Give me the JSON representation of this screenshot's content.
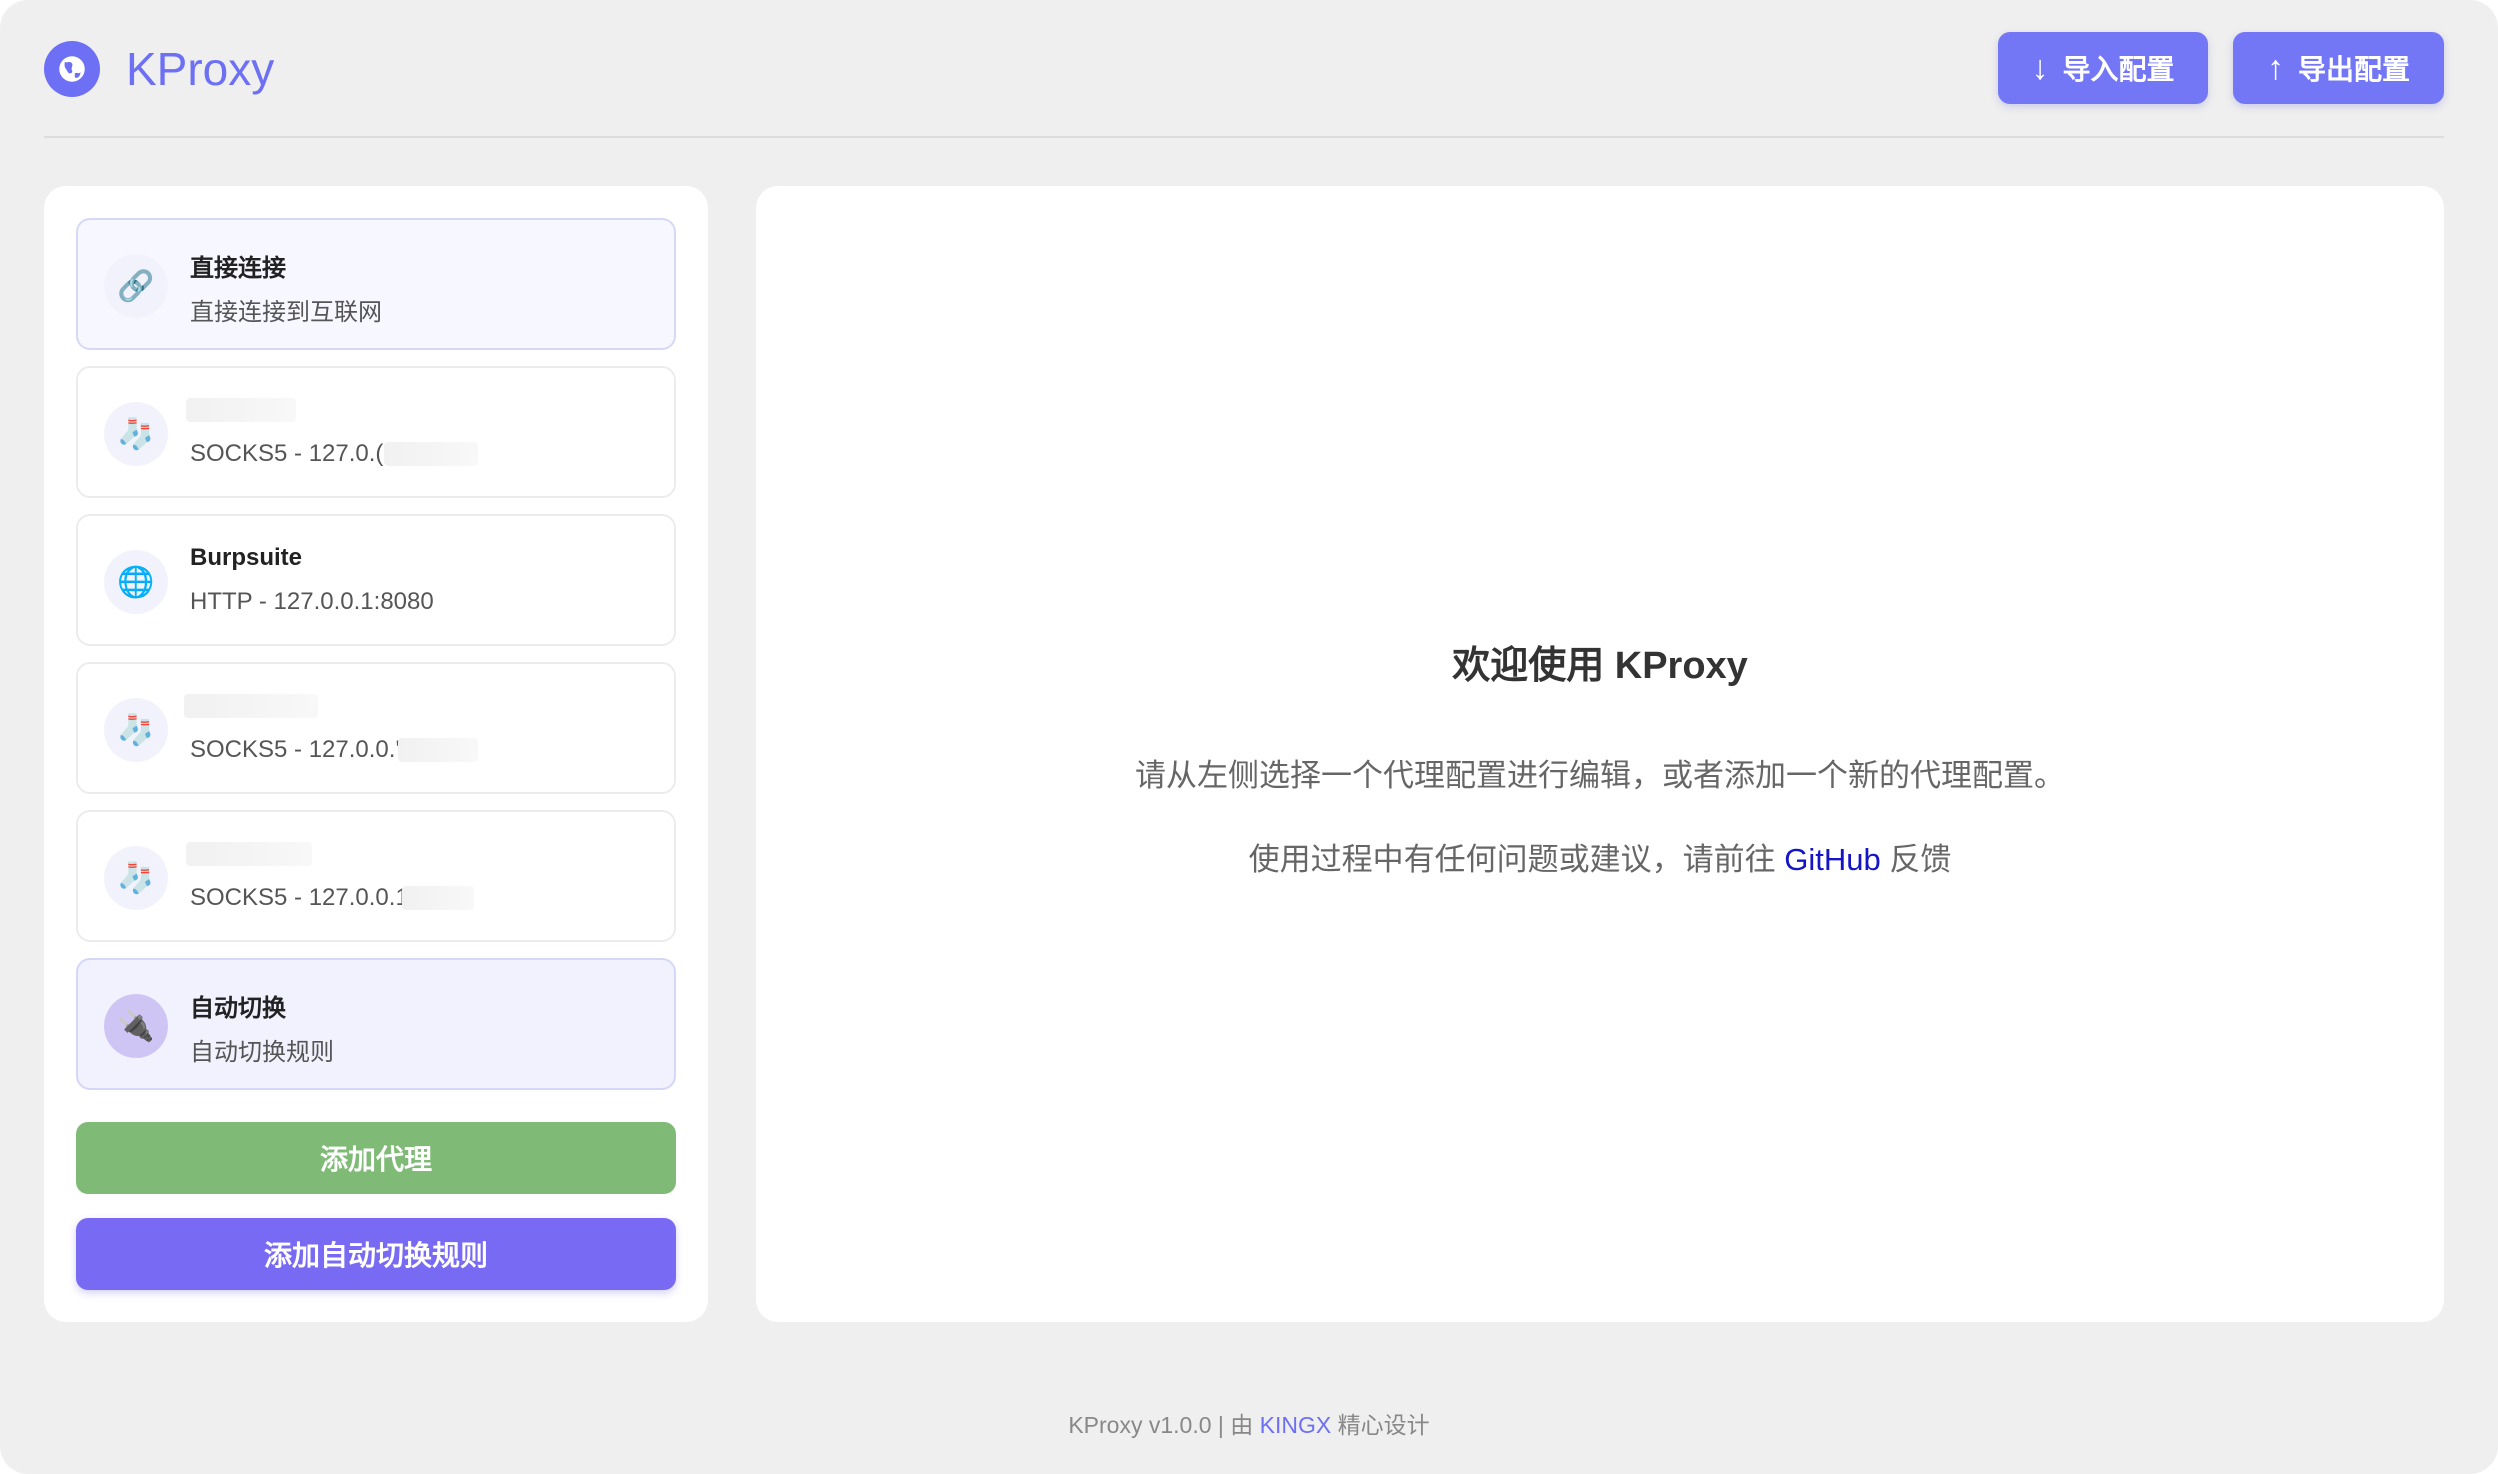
{
  "header": {
    "app_title": "KProxy",
    "brand_icon": "globe-icon",
    "import_button": {
      "icon": "↓",
      "label": "导入配置"
    },
    "export_button": {
      "icon": "↑",
      "label": "导出配置"
    }
  },
  "sidebar": {
    "items": [
      {
        "icon": "🔗",
        "icon_name": "link-icon",
        "title": "直接连接",
        "subtitle": "直接连接到互联网"
      },
      {
        "icon": "🧦",
        "icon_name": "sock-icon",
        "title": "",
        "subtitle": "SOCKS5 - 127.0.("
      },
      {
        "icon": "🌐",
        "icon_name": "globe-icon",
        "title": "Burpsuite",
        "subtitle": "HTTP - 127.0.0.1:8080"
      },
      {
        "icon": "🧦",
        "icon_name": "sock-icon",
        "title": "",
        "subtitle": "SOCKS5 - 127.0.0.'"
      },
      {
        "icon": "🧦",
        "icon_name": "sock-icon",
        "title": "",
        "subtitle": "SOCKS5 - 127.0.0.1"
      },
      {
        "icon": "🔌",
        "icon_name": "plug-icon",
        "title": "自动切换",
        "subtitle": "自动切换规则"
      }
    ],
    "add_proxy_label": "添加代理",
    "add_rule_label": "添加自动切换规则"
  },
  "main": {
    "welcome_title": "欢迎使用 KProxy",
    "welcome_text": "请从左侧选择一个代理配置进行编辑，或者添加一个新的代理配置。",
    "feedback_prefix": "使用过程中有任何问题或建议，请前往",
    "feedback_link": "GitHub",
    "feedback_suffix": "反馈"
  },
  "footer": {
    "version_text": "KProxy v1.0.0 | 由",
    "author": "KINGX",
    "suffix": "精心设计"
  },
  "colors": {
    "accent": "#6d70f4",
    "button": "#7377f6",
    "add_proxy": "#7fbb76",
    "add_rule": "#786af2",
    "link": "#1515c8"
  }
}
